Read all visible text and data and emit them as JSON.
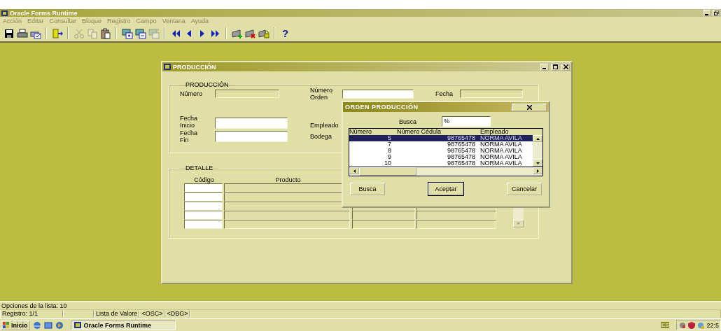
{
  "app_window": {
    "title": "Oracle Forms Runtime"
  },
  "menu": [
    "Acción",
    "Editar",
    "Consultar",
    "Bloque",
    "Registro",
    "Campo",
    "Ventana",
    "Ayuda"
  ],
  "toolbar": [
    {
      "disabled": false
    },
    {
      "disabled": false
    },
    {
      "disabled": false
    },
    {
      "disabled": false
    },
    {
      "disabled": true
    },
    {
      "disabled": true
    },
    {
      "disabled": false
    },
    {
      "disabled": false
    },
    {
      "disabled": false
    },
    {
      "disabled": true
    },
    {
      "disabled": false
    },
    {
      "disabled": false
    },
    {
      "disabled": false
    },
    {
      "disabled": false
    },
    {
      "disabled": false
    },
    {
      "disabled": false
    },
    {
      "disabled": false
    },
    {
      "disabled": false,
      "label": "?"
    }
  ],
  "form_window": {
    "title": "PRODUCCIÓN",
    "header_section": {
      "title": "PRODUCCIÓN",
      "fields": [
        {
          "label": "Número",
          "disabled": true
        },
        {
          "label": "Número Orden",
          "disabled": false
        },
        {
          "label": "Fecha",
          "disabled": true
        },
        {
          "label": "Fecha Inicio",
          "disabled": false
        },
        {
          "label": "Empleado"
        },
        {
          "label": "Fecha Fin",
          "disabled": false
        },
        {
          "label": "Bodega"
        }
      ]
    },
    "detail_section": {
      "title": "DETALLE",
      "columns": [
        "Código",
        "Producto"
      ]
    }
  },
  "lov_dialog": {
    "title": "ORDEN PRODUCCIÓN",
    "search_label": "Busca",
    "search_value": "%",
    "columns": [
      "Número",
      "Número Cédula",
      "Empleado"
    ],
    "rows": [
      {
        "cells": [
          "5",
          "98765478",
          "NORMA AVILA"
        ],
        "selected": true
      },
      {
        "cells": [
          "7",
          "98765478",
          "NORMA AVILA"
        ],
        "selected": false
      },
      {
        "cells": [
          "8",
          "98765478",
          "NORMA AVILA"
        ],
        "selected": false
      },
      {
        "cells": [
          "9",
          "98765478",
          "NORMA AVILA"
        ],
        "selected": false
      },
      {
        "cells": [
          "10",
          "98765478",
          "NORMA AVILA"
        ],
        "selected": false
      }
    ],
    "buttons": [
      {
        "label": "Busca",
        "default": false
      },
      {
        "label": "Aceptar",
        "default": true
      },
      {
        "label": "Cancelar",
        "default": false
      }
    ]
  },
  "status_bar": {
    "message": "Opciones de la lista: 10",
    "record": "Registro: 1/1",
    "fields": [
      "Lista de Valore",
      "<OSC>",
      "<DBG>"
    ]
  },
  "taskbar": {
    "start": "Inicio",
    "tasks": [
      "Oracle Forms Runtime"
    ],
    "language": "ES",
    "clock": "22:5"
  }
}
